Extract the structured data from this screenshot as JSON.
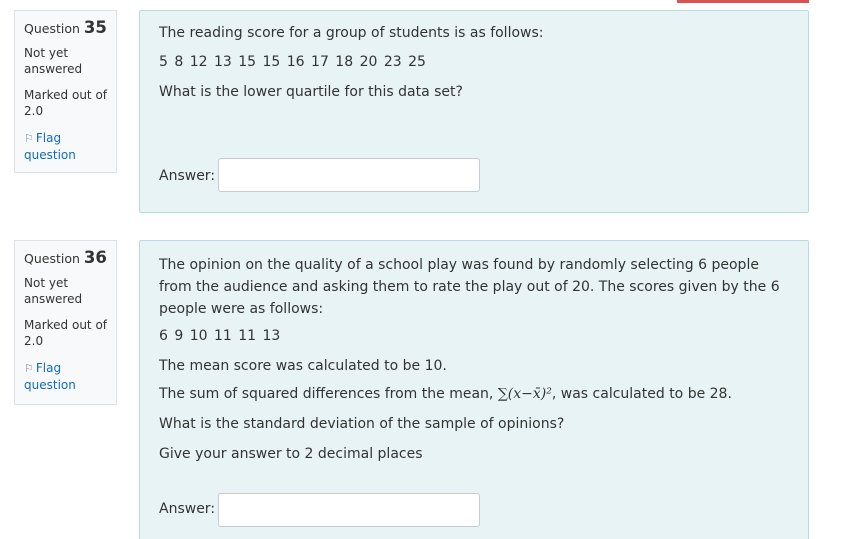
{
  "q35": {
    "label": "Question",
    "number": "35",
    "state": "Not yet answered",
    "grade": "Marked out of 2.0",
    "flag": "Flag question",
    "text1": "The reading score for a group of students is as follows:",
    "data": "5  8  12  13  15  15  16  17  18  20  23  25",
    "text2": "What is the lower quartile for this data set?",
    "answer_label": "Answer:",
    "answer_value": ""
  },
  "q36": {
    "label": "Question",
    "number": "36",
    "state": "Not yet answered",
    "grade": "Marked out of 2.0",
    "flag": "Flag question",
    "text1": "The opinion on the quality of a school play was found by randomly selecting 6 people from the audience and asking them to rate the play out of 20. The scores given by the 6 people were as follows:",
    "data": "6  9  10  11  11  13",
    "text2": "The mean score was calculated to be 10.",
    "text3_prefix": "The sum of squared differences from the mean,",
    "formula": "∑(x−x̄)²",
    "text3_suffix": ", was calculated to be 28.",
    "text4": "What is the standard deviation of the sample of opinions?",
    "text5": "Give your answer to 2 decimal places",
    "answer_label": "Answer:",
    "answer_value": ""
  },
  "icons": {
    "flag": "flag-icon"
  },
  "colors": {
    "link": "#0f6cbf",
    "panel": "#e7f3f5",
    "panel_border": "#b8dce2",
    "accent": "#d9534f"
  }
}
